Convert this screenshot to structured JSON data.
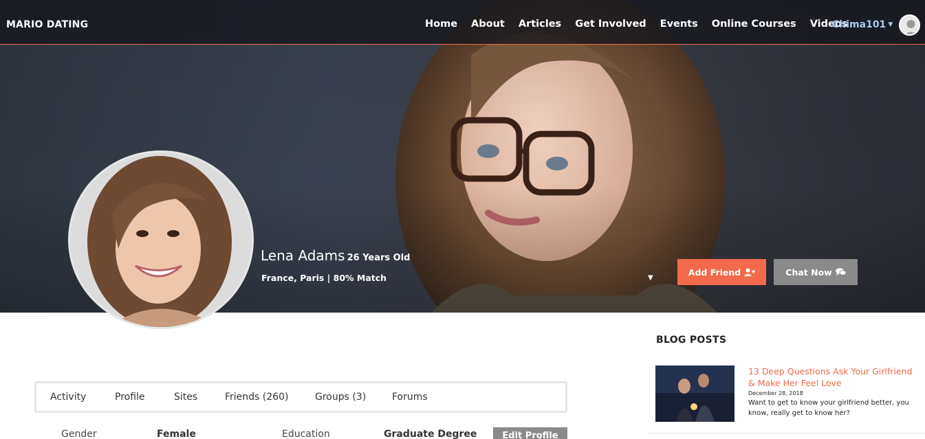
{
  "brand": "MARIO DATING",
  "nav": {
    "links": [
      "Home",
      "About",
      "Articles",
      "Get Involved",
      "Events",
      "Online Courses",
      "Videos"
    ],
    "user": "Chima101",
    "user_icon": "caret-down-icon"
  },
  "profile": {
    "name": "Lena Adams",
    "age": "26 Years Old",
    "location": "France, Paris | 80% Match",
    "add_friend_label": "Add Friend",
    "chat_label": "Chat Now"
  },
  "tabs": [
    "Activity",
    "Profile",
    "Sites",
    "Friends (260)",
    "Groups (3)",
    "Forums"
  ],
  "info": {
    "gender_label": "Gender",
    "gender_value": "Female",
    "education_label": "Education",
    "education_value": "Graduate Degree",
    "edit_label": "Edit Profile"
  },
  "sidebar": {
    "title": "BLOG POSTS",
    "posts": [
      {
        "title": "13 Deep Questions Ask Your Girlfriend & Make Her Feel Love",
        "date": "December 28, 2018",
        "excerpt": "Want to get to know your girlfriend better, you know, really get to know her?"
      }
    ]
  },
  "colors": {
    "accent": "#f26a4b",
    "secondary_button": "#8a8a8a",
    "user_link": "#a9c9f0"
  }
}
